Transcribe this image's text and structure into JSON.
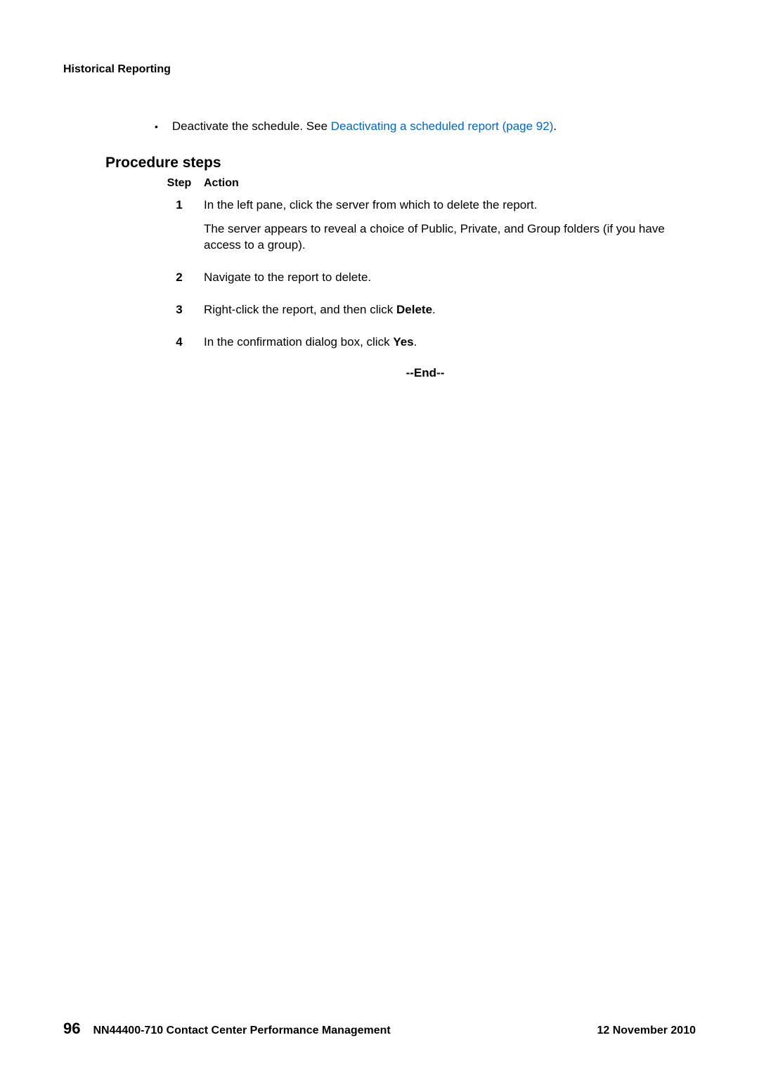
{
  "header": {
    "running_title": "Historical Reporting"
  },
  "bullet": {
    "text_before_link": "Deactivate the schedule. See ",
    "link_text": "Deactivating a scheduled report (page 92)",
    "text_after_link": "."
  },
  "section": {
    "heading": "Procedure steps",
    "step_label": "Step",
    "action_label": "Action"
  },
  "steps": [
    {
      "num": "1",
      "lines": [
        "In the left pane, click the server from which to delete the report.",
        "The server appears to reveal a choice of Public, Private, and Group folders (if you have access to a group)."
      ]
    },
    {
      "num": "2",
      "lines": [
        "Navigate to the report to delete."
      ]
    },
    {
      "num": "3",
      "action_prefix": "Right-click the report, and then click ",
      "action_bold": "Delete",
      "action_suffix": "."
    },
    {
      "num": "4",
      "action_prefix": "In the confirmation dialog box, click ",
      "action_bold": "Yes",
      "action_suffix": "."
    }
  ],
  "end_marker": "--End--",
  "footer": {
    "page_number": "96",
    "doc_title": "NN44400-710 Contact Center Performance Management",
    "date": "12 November 2010"
  }
}
